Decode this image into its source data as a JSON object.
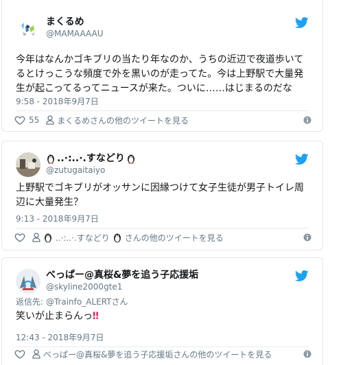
{
  "tweets": [
    {
      "display_name": "まくるめ",
      "handle": "@MAMAAAAU",
      "text": "今年はなんかゴキブリの当たり年なのか、うちの近辺で夜道歩いてるとけっこうな頻度で外を黒いのが走ってた。今は上野駅で大量発生が起こってるってニュースが来た。ついに……はじまるのだな",
      "timestamp": "9:58 - 2018年9月7日",
      "likes": "55",
      "more_link": "まくるめさんの他のツイートを見る"
    },
    {
      "display_name_pre": "..·:..·.すなどり",
      "handle": "@zutugaitaiyo",
      "text": "上野駅でゴキブリがオッサンに因縁つけて女子生徒が男子トイレ周辺に大量発生？",
      "timestamp": "9:13 - 2018年9月7日",
      "likes": "",
      "more_link_pre": "..·:..·.すなどり",
      "more_link_post": "さんの他のツイートを見る"
    },
    {
      "display_name": "べっぱー@真桜&夢を追う子応援垢",
      "handle": "@skyline2000gte1",
      "reply_label": "返信先: ",
      "reply_mention": "@Trainfo_ALERT",
      "reply_suffix": "さん",
      "text": "笑いが止まらんっ",
      "text_emoji": "‼",
      "timestamp": "12:43 - 2018年9月7日",
      "likes": "",
      "more_link": "べっぱー@真桜&夢を追う子応援垢さんの他のツイートを見る"
    }
  ],
  "colors": {
    "twitter_blue": "#1da1f2",
    "muted": "#657786",
    "border": "#e1e8ed",
    "text": "#14171a",
    "exclaim": "#e0245e"
  },
  "icons": [
    "twitter-bird-icon",
    "heart-icon",
    "person-icon",
    "info-icon",
    "penguin-emoji"
  ]
}
